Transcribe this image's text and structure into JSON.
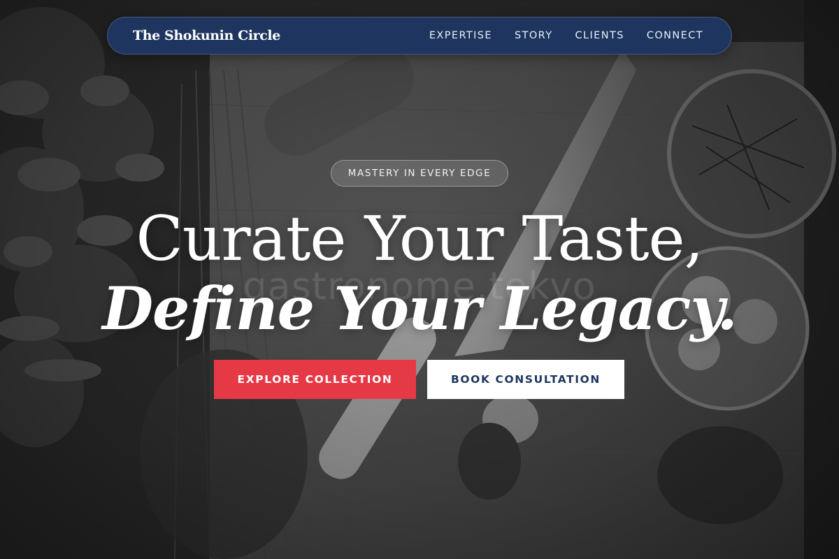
{
  "nav": {
    "brand": "The Shokunin Circle",
    "links": [
      "EXPERTISE",
      "STORY",
      "CLIENTS",
      "CONNECT"
    ]
  },
  "hero": {
    "tagline": "MASTERY IN EVERY EDGE",
    "headline_line1": "Curate Your Taste,",
    "headline_line2": "Define Your Legacy.",
    "watermark": "gastronome.tokyo",
    "primary_cta": "EXPLORE COLLECTION",
    "secondary_cta": "BOOK CONSULTATION"
  },
  "colors": {
    "nav_background": "#1e365f",
    "primary_button": "#e63946",
    "secondary_button": "#ffffff",
    "secondary_button_text": "#1e365f"
  }
}
